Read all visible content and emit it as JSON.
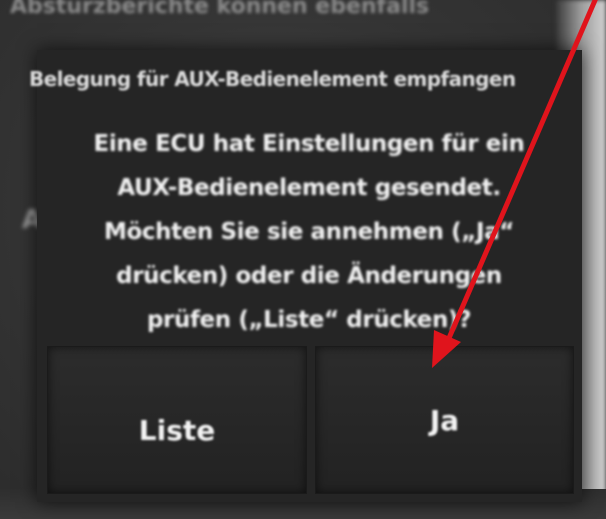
{
  "background": {
    "header_text": "Absturzberichte können ebenfalls",
    "left_glyph": "A"
  },
  "dialog": {
    "title": "Belegung für AUX-Bedienelement empfangen",
    "message_lines": [
      "Eine ECU hat Einstellungen für ein",
      "AUX-Bedienelement gesendet.",
      "Möchten Sie sie annehmen („Ja“",
      "drücken) oder die Änderungen",
      "prüfen („Liste“ drücken)?"
    ],
    "buttons": {
      "liste": "Liste",
      "ja": "Ja"
    }
  },
  "annotation": {
    "arrow_color": "#e0141c",
    "points_to": "ja-button"
  }
}
